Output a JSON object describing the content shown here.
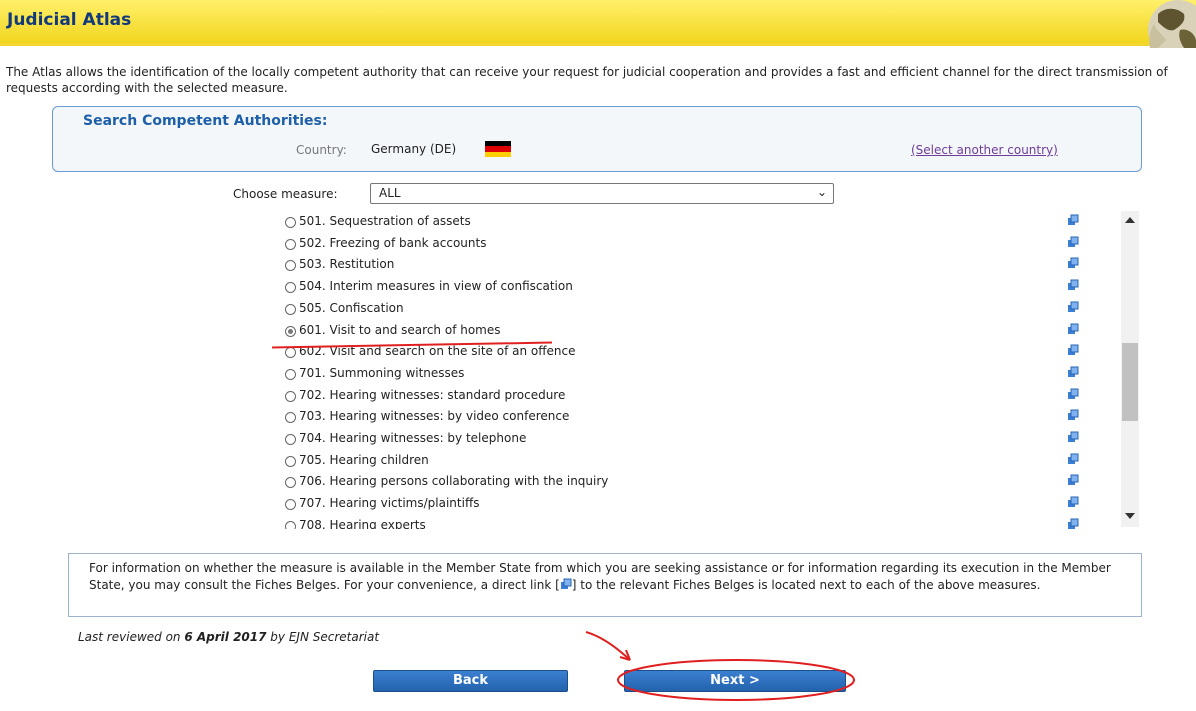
{
  "header": {
    "title": "Judicial Atlas"
  },
  "intro": "The Atlas allows the identification of the locally competent authority that can receive your request for judicial cooperation and provides a fast and efficient channel for the direct transmission of requests according with the selected measure.",
  "search": {
    "heading": "Search Competent Authorities:",
    "country_label": "Country:",
    "country_value": "Germany (DE)",
    "other_link": "(Select another country)"
  },
  "measure": {
    "label": "Choose measure:",
    "selected": "ALL"
  },
  "measures": [
    "501. Sequestration of assets",
    "502. Freezing of bank accounts",
    "503. Restitution",
    "504. Interim measures in view of confiscation",
    "505. Confiscation",
    "601. Visit to and search of homes",
    "602. Visit and search on the site of an offence",
    "701. Summoning witnesses",
    "702. Hearing witnesses: standard procedure",
    "703. Hearing witnesses: by video conference",
    "704. Hearing witnesses: by telephone",
    "705. Hearing children",
    "706. Hearing persons collaborating with the inquiry",
    "707. Hearing victims/plaintiffs",
    "708. Hearing experts"
  ],
  "selected_measure": "601. Visit to and search of homes",
  "info": {
    "before": "For information on whether the measure is available in the Member State from which you are seeking assistance or for information regarding its execution in the Member State, you may consult the Fiches Belges. For your convenience, a direct link [",
    "after": "] to the relevant Fiches Belges is located next to each of the above measures."
  },
  "reviewed": {
    "prefix": "Last reviewed on ",
    "date": "6 April 2017",
    "suffix": " by EJN Secretariat"
  },
  "buttons": {
    "back": "Back",
    "next": "Next >"
  },
  "colors": {
    "header": "#f5dd2a",
    "heading": "#1d5fa8",
    "button": "#2d6fbf",
    "annotation": "#e02020"
  },
  "flag_colors": [
    "#000000",
    "#dd0000",
    "#ffce00"
  ]
}
